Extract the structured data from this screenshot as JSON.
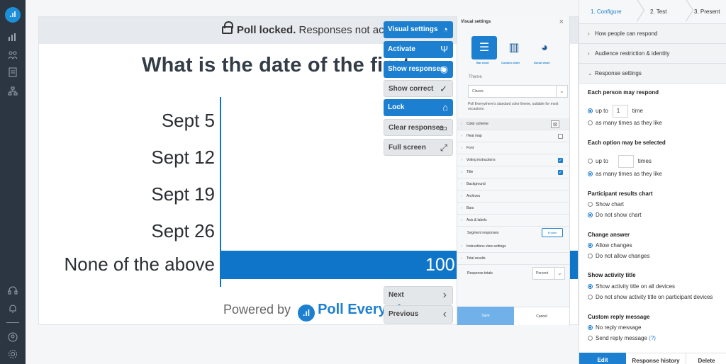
{
  "rail": {
    "logo": ".ıl",
    "icons": [
      "bar-chart-icon",
      "people-icon",
      "document-icon",
      "org-icon",
      "headset-icon",
      "bell-icon",
      "account-icon",
      "settings-icon"
    ]
  },
  "stage": {
    "lock_bold": "Poll locked.",
    "lock_rest": " Responses not accepted",
    "question": "What is the date of the first",
    "options": [
      "Sept 5",
      "Sept 12",
      "Sept 19",
      "Sept 26",
      "None of the above"
    ],
    "results_percent": [
      0,
      0,
      0,
      0,
      100
    ],
    "bar_value_text": "100",
    "powered_by": "Powered by",
    "brand": "Poll Everywhere"
  },
  "actions": {
    "visual_settings": "Visual settings",
    "activate": "Activate",
    "show_responses": "Show responses",
    "show_correct": "Show correct",
    "lock": "Lock",
    "clear_responses": "Clear responses",
    "full_screen": "Full screen",
    "next": "Next",
    "previous": "Previous"
  },
  "visual_panel": {
    "title": "Visual settings",
    "chart_types": [
      "Bar chart",
      "Column chart",
      "Donut chart"
    ],
    "selected_chart_type": "Bar chart",
    "theme_label": "Theme",
    "theme_value": "Classic",
    "theme_desc": "Poll Everywhere's standard color theme, suitable for most occasions",
    "rows": [
      {
        "label": "Color scheme"
      },
      {
        "label": "Heat map",
        "checked": false
      },
      {
        "label": "Font"
      },
      {
        "label": "Voting instructions",
        "checked": true
      },
      {
        "label": "Title",
        "checked": true
      },
      {
        "label": "Background"
      },
      {
        "label": "Archives"
      },
      {
        "label": "Bars"
      },
      {
        "label": "Axis & labels"
      }
    ],
    "segment_label": "Segment responses",
    "segment_button": "Enable",
    "instructions_view": "Instructions view settings",
    "total_results": "Total results",
    "response_totals_label": "Response totals",
    "response_totals_value": "Percent",
    "save": "Save",
    "cancel": "Cancel"
  },
  "right_panel": {
    "steps": [
      "1. Configure",
      "2. Test",
      "3. Present"
    ],
    "active_step": "1. Configure",
    "accordions": [
      "How people can respond",
      "Audience restriction & identity",
      "Response settings"
    ],
    "each_person_title": "Each person may respond",
    "up_to": "up to",
    "respond_count": "1",
    "time": "time",
    "times": "times",
    "as_many_times": "as many times as they like",
    "each_option_title": "Each option may be selected",
    "option_count": "",
    "results_chart_title": "Participant results chart",
    "show_chart": "Show chart",
    "do_not_show_chart": "Do not show chart",
    "change_answer_title": "Change answer",
    "allow_changes": "Allow changes",
    "do_not_allow_changes": "Do not allow changes",
    "activity_title_title": "Show activity title",
    "show_on_all": "Show activity title on all devices",
    "do_not_show_on_participant": "Do not show activity title on participant devices",
    "custom_reply_title": "Custom reply message",
    "no_reply": "No reply message",
    "send_reply": "Send reply message",
    "help_mark": "(?)",
    "tabs": [
      "Edit",
      "Response history",
      "Delete"
    ]
  },
  "colors": {
    "accent": "#1c7fd0",
    "rail": "#2b3642",
    "bar": "#0f75c9"
  }
}
